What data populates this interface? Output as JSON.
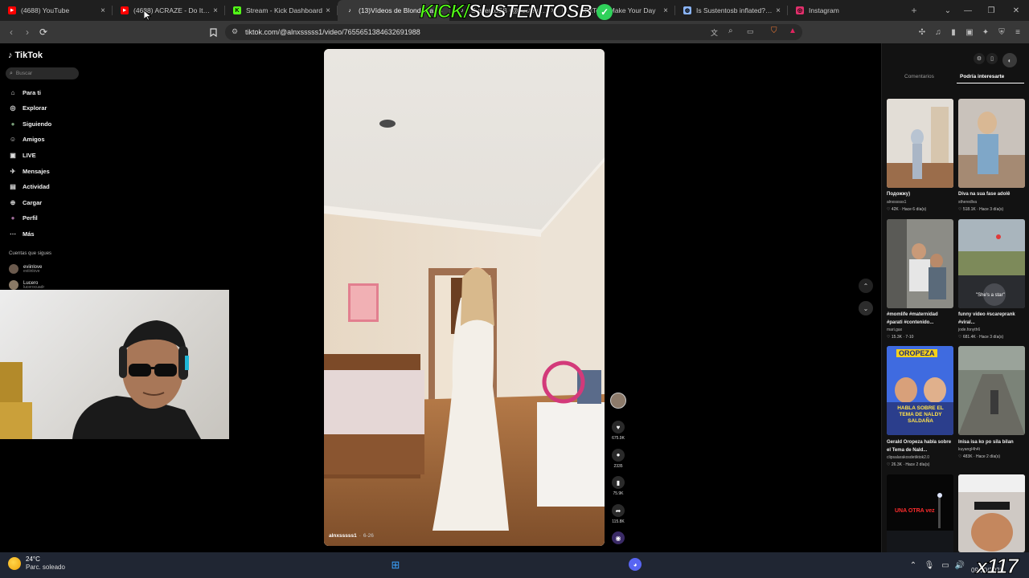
{
  "browser": {
    "tabs": [
      {
        "title": "(4688) YouTube",
        "icon": "youtube-icon",
        "color": "#ff0000"
      },
      {
        "title": "(4688) ACRAZE - Do It To",
        "icon": "youtube-icon",
        "color": "#ff0000"
      },
      {
        "title": "Stream - Kick Dashboard",
        "icon": "kick-icon",
        "color": "#53fc18"
      },
      {
        "title": "(13)Vídeos de Blondinka",
        "icon": "tiktok-icon",
        "color": "#ffffff",
        "active": true
      },
      {
        "title": "SustentoSB (@sustentosb) | T",
        "icon": "tiktok-icon",
        "color": "#ffffff"
      },
      {
        "title": "TikTok - Make Your Day",
        "icon": "tiktok-icon",
        "color": "#ffffff"
      },
      {
        "title": "Is Sustentosb inflated? Kick er",
        "icon": "globe-icon",
        "color": "#8ab4f8"
      },
      {
        "title": "Instagram",
        "icon": "instagram-icon",
        "color": "#e1306c"
      }
    ],
    "close_glyph": "×",
    "new_tab_glyph": "+",
    "url": "tiktok.com/@alnxsssss1/video/7655651384632691988"
  },
  "tiktok": {
    "logo": "TikTok",
    "search_placeholder": "Buscar",
    "nav": [
      {
        "label": "Para ti",
        "icon": "home-icon"
      },
      {
        "label": "Explorar",
        "icon": "compass-icon"
      },
      {
        "label": "Siguiendo",
        "icon": "following-icon"
      },
      {
        "label": "Amigos",
        "icon": "friends-icon"
      },
      {
        "label": "LIVE",
        "icon": "live-icon"
      },
      {
        "label": "Mensajes",
        "icon": "messages-icon"
      },
      {
        "label": "Actividad",
        "icon": "activity-icon"
      },
      {
        "label": "Cargar",
        "icon": "upload-icon"
      },
      {
        "label": "Perfil",
        "icon": "profile-icon"
      },
      {
        "label": "Más",
        "icon": "more-icon"
      }
    ],
    "following_title": "Cuentas que sigues",
    "following": [
      {
        "name": "eviinlove",
        "handle": "eviiinlove"
      },
      {
        "name": "Lucero",
        "handle": "lucerocuadr"
      }
    ],
    "video": {
      "author": "alnxsssss1",
      "date": "6-26"
    },
    "actions": [
      {
        "icon": "heart-icon",
        "count": "675.9K"
      },
      {
        "icon": "comment-icon",
        "count": "2335"
      },
      {
        "icon": "bookmark-icon",
        "count": "75.9K"
      },
      {
        "icon": "share-icon",
        "count": "115.8K"
      }
    ],
    "panel": {
      "tab_comments": "Comentarios",
      "tab_suggested": "Podría interesarte",
      "items": [
        {
          "title": "Подожжу)",
          "user": "alnxsssss1",
          "stats": "♡ 42K · Hace 6 día(s)"
        },
        {
          "title": "Diva na sua fase adolê",
          "user": "stheredlva",
          "stats": "♡ 518.1K · Hace 3 día(s)"
        },
        {
          "title": "#momlife #maternidad #parati #contenido...",
          "user": "mari.gax",
          "stats": "♡ 15.3K · 7-10"
        },
        {
          "title": "funny video #scareprank #viral...",
          "user": "jode.fonyth6",
          "stats": "♡ 681.4K · Hace 3 día(s)"
        },
        {
          "title": "Gerald Oropeza habla sobre el Tema de Nald...",
          "user": "clipsalarakosdetiktok2.0",
          "stats": "♡ 26.3K · Hace 2 día(s)"
        },
        {
          "title": "Inisa isa ko po sila bilan",
          "user": "kuyangl4h4t",
          "stats": "♡ 483K · Hace 2 día(s)"
        }
      ],
      "overlay_text_4": "\"She's a star\"",
      "overlay_text_5a": "OROPEZA",
      "overlay_text_5b": "HABLA SOBRE EL TEMA DE NALDY SALDAÑA",
      "overlay_text_7": "UNA OTRA vez"
    }
  },
  "taskbar": {
    "temp": "24°C",
    "weather": "Parc. soleado",
    "kick_a": "KICK/",
    "kick_b": "SUSTENTOSB",
    "overlay": "x117",
    "clock": "09/10/2025"
  }
}
